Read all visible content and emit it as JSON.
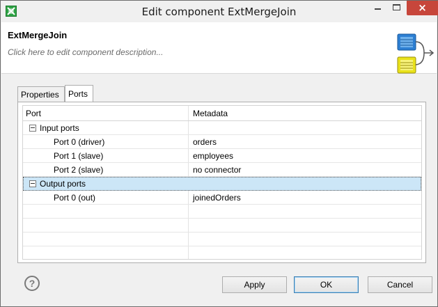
{
  "window": {
    "title": "Edit component ExtMergeJoin",
    "min_label": "–",
    "close_label": "×"
  },
  "component": {
    "name": "ExtMergeJoin",
    "description_placeholder": "Click here to edit component description..."
  },
  "tabs": [
    {
      "label": "Properties",
      "active": false
    },
    {
      "label": "Ports",
      "active": true
    }
  ],
  "table": {
    "columns": [
      "Port",
      "Metadata"
    ],
    "rows": [
      {
        "port": "Input ports",
        "metadata": "",
        "group": true,
        "expanded": true
      },
      {
        "port": "Port 0 (driver)",
        "metadata": "orders",
        "group": false
      },
      {
        "port": "Port 1 (slave)",
        "metadata": "employees",
        "group": false
      },
      {
        "port": "Port 2 (slave)",
        "metadata": "no connector",
        "group": false
      },
      {
        "port": "Output ports",
        "metadata": "",
        "group": true,
        "expanded": true,
        "selected": true
      },
      {
        "port": "Port 0 (out)",
        "metadata": "joinedOrders",
        "group": false
      }
    ]
  },
  "footer": {
    "help_glyph": "?",
    "apply_label": "Apply",
    "ok_label": "OK",
    "cancel_label": "Cancel"
  },
  "colors": {
    "close_button": "#c7463b",
    "selection": "#cce6f7",
    "app_icon": "#2ea345",
    "graphic_blue": "#2d7fd3",
    "graphic_yellow": "#e9e21a"
  },
  "icons": {
    "app": "clover-app-icon",
    "component_graphic": "merge-join-component-icon",
    "help": "help-icon"
  }
}
